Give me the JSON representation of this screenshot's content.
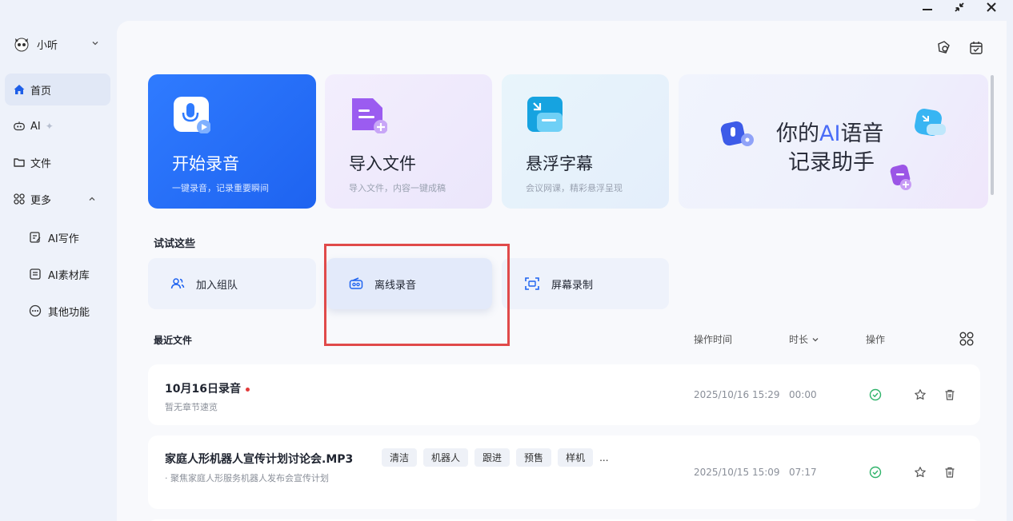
{
  "user": {
    "name": "小听"
  },
  "nav": {
    "home": "首页",
    "ai": "AI",
    "files": "文件",
    "more": "更多",
    "ai_writing": "AI写作",
    "ai_materials": "AI素材库",
    "other": "其他功能"
  },
  "cards": {
    "record": {
      "title": "开始录音",
      "subtitle": "一键录音，记录重要瞬间"
    },
    "import": {
      "title": "导入文件",
      "subtitle": "导入文件，内容一键成稿"
    },
    "subtitle": {
      "title": "悬浮字幕",
      "subtitle": "会议网课，精彩悬浮呈现"
    }
  },
  "banner": {
    "line1_prefix": "你的",
    "line1_ai": "AI",
    "line1_suffix": "语音",
    "line2": "记录助手"
  },
  "try_section": {
    "title": "试试这些",
    "items": [
      "加入组队",
      "离线录音",
      "屏幕录制"
    ]
  },
  "recent": {
    "title": "最近文件",
    "col_time": "操作时间",
    "col_duration": "时长",
    "col_action": "操作",
    "files": [
      {
        "name": "10月16日录音",
        "sub": "暂无章节速览",
        "time": "2025/10/16 15:29",
        "duration": "00:00",
        "tags": []
      },
      {
        "name": "家庭人形机器人宣传计划讨论会.MP3",
        "sub": "· 聚焦家庭人形服务机器人发布会宣传计划",
        "time": "2025/10/15 15:09",
        "duration": "07:17",
        "tags": [
          "清洁",
          "机器人",
          "跟进",
          "预售",
          "样机"
        ],
        "tags_more": "..."
      }
    ]
  },
  "colors": {
    "accent": "#1e63f0",
    "highlight_box": "#e04a4a",
    "success": "#2fb36a"
  }
}
